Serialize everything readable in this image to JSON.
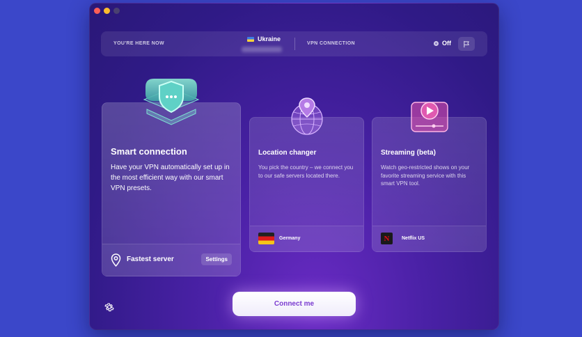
{
  "window": {
    "controls": [
      "close",
      "minimize",
      "zoom"
    ]
  },
  "status_bar": {
    "location_label": "YOU'RE HERE NOW",
    "country": "Ukraine",
    "country_flag": "ukraine-flag",
    "vpn_label": "VPN CONNECTION",
    "vpn_status": "Off",
    "report_icon": "flag-icon"
  },
  "cards": {
    "smart": {
      "title": "Smart connection",
      "description": "Have your VPN automatically set up in the most efficient way with our smart VPN presets.",
      "footer_label": "Fastest server",
      "settings_label": "Settings",
      "icon": "shield-icon"
    },
    "location": {
      "title": "Location changer",
      "description": "You pick the country – we connect you to our safe servers located there.",
      "footer_label": "Germany",
      "footer_icon": "germany-flag",
      "icon": "globe-pin-icon"
    },
    "streaming": {
      "title": "Streaming (beta)",
      "description": "Watch geo-restricted shows on your favorite streaming service with this smart VPN tool.",
      "footer_label": "Netflix US",
      "footer_icon": "netflix-logo",
      "icon": "play-screen-icon"
    }
  },
  "connect_button": "Connect me",
  "colors": {
    "background": "#3b47c9",
    "accent": "#7a3bd0",
    "shield": "#63d6c8",
    "globe": "#b07ae6",
    "stream": "#e04aa8"
  }
}
